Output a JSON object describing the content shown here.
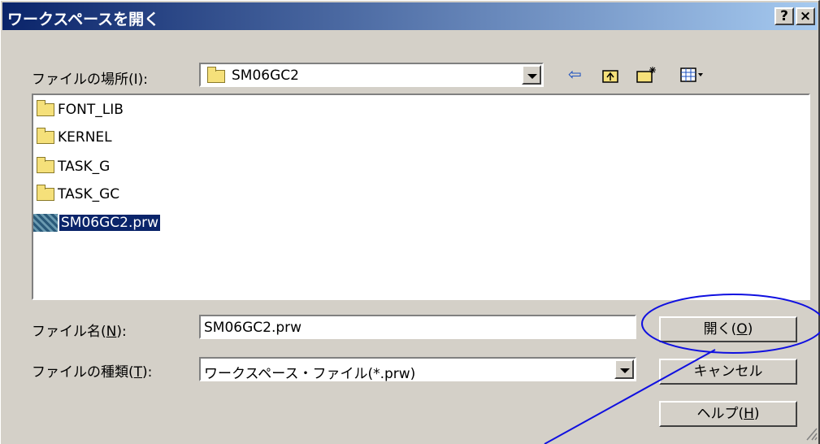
{
  "window": {
    "title": "ワークスペースを開く",
    "help_button": "?",
    "close_button": "×"
  },
  "lookin": {
    "label": "ファイルの場所(I):",
    "value": "SM06GC2"
  },
  "toolbar": {
    "back_icon": "back-arrow-icon",
    "up_icon": "up-folder-icon",
    "new_folder_icon": "new-folder-icon",
    "view_icon": "view-menu-icon"
  },
  "files": [
    {
      "name": "FONT_LIB",
      "type": "folder"
    },
    {
      "name": "KERNEL",
      "type": "folder"
    },
    {
      "name": "TASK_G",
      "type": "folder"
    },
    {
      "name": "TASK_GC",
      "type": "folder"
    },
    {
      "name": "SM06GC2.prw",
      "type": "workspace",
      "selected": true
    }
  ],
  "filename": {
    "label_main": "ファイル名(",
    "label_key": "N",
    "label_end": "):",
    "value": "SM06GC2.prw"
  },
  "filetype": {
    "label_main": "ファイルの種類(",
    "label_key": "T",
    "label_end": "):",
    "value": "ワークスペース・ファイル(*.prw)"
  },
  "buttons": {
    "open_main": "開く(",
    "open_key": "O",
    "open_end": ")",
    "cancel": "キャンセル",
    "help_main": "ヘルプ(",
    "help_key": "H",
    "help_end": ")"
  },
  "annotation_color": "#0000ff"
}
